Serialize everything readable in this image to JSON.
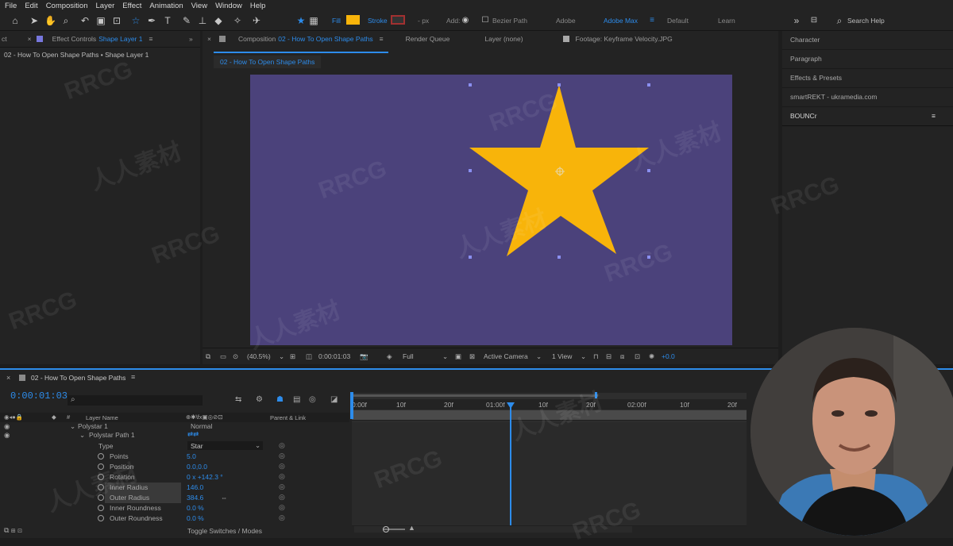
{
  "menu": [
    "File",
    "Edit",
    "Composition",
    "Layer",
    "Effect",
    "Animation",
    "View",
    "Window",
    "Help"
  ],
  "toolbar": {
    "fill_label": "Fill",
    "fill_color": "#f8b40a",
    "stroke_label": "Stroke",
    "stroke_unit": "- px",
    "add_label": "Add:",
    "bezier_label": "Bezier Path",
    "workspaces": [
      "Adobe",
      "Adobe Max",
      "Default",
      "Learn"
    ],
    "active_workspace": "Adobe Max",
    "search_placeholder": "Search Help"
  },
  "left_panel": {
    "tab_prefix": "ct",
    "tab_label": "Effect Controls",
    "tab_layer": "Shape Layer 1",
    "breadcrumb": "02 - How To Open Shape Paths • Shape Layer 1"
  },
  "comp_panel": {
    "tab_label": "Composition",
    "tab_comp": "02 - How To Open Shape Paths",
    "other_tabs": [
      "Render Queue",
      "Layer (none)",
      "Footage: Keyframe Velocity.JPG"
    ],
    "sub_tab": "02 - How To Open Shape Paths"
  },
  "right_panel": [
    "Character",
    "Paragraph",
    "Effects & Presets",
    "smartREKT - ukramedia.com",
    "BOUNCr"
  ],
  "viewer_bar": {
    "zoom": "(40.5%)",
    "time": "0:00:01:03",
    "resolution": "Full",
    "camera": "Active Camera",
    "views": "1 View",
    "exposure": "+0.0"
  },
  "colors": {
    "comp_bg": "#4b427b",
    "star": "#f8b40a",
    "accent": "#2d8ceb"
  },
  "timeline": {
    "comp_name": "02 - How To Open Shape Paths",
    "timecode": "0:00:01:03",
    "col_layer_name": "Layer Name",
    "col_parent": "Parent & Link",
    "ruler": [
      "0:00f",
      "10f",
      "20f",
      "01:00f",
      "10f",
      "20f",
      "02:00f",
      "10f",
      "20f"
    ],
    "footer": "Toggle Switches / Modes",
    "rows": {
      "polystar": "Polystar 1",
      "blend": "Normal",
      "path": "Polystar Path 1",
      "type_label": "Type",
      "type_value": "Star"
    },
    "props": [
      {
        "name": "Points",
        "value": "5.0"
      },
      {
        "name": "Position",
        "value": "0.0,0.0"
      },
      {
        "name": "Rotation",
        "value": "0 x +142.3 °"
      },
      {
        "name": "Inner Radius",
        "value": "146.0"
      },
      {
        "name": "Outer Radius",
        "value": "384.6"
      },
      {
        "name": "Inner Roundness",
        "value": "0.0 %"
      },
      {
        "name": "Outer Roundness",
        "value": "0.0 %"
      }
    ]
  },
  "watermarks": {
    "latin": "RRCG",
    "cjk": "人人素材"
  }
}
